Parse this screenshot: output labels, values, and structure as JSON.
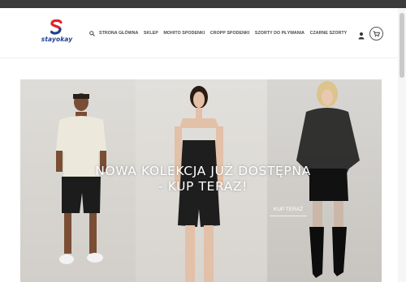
{
  "brand": {
    "name": "stayokay"
  },
  "nav": {
    "items": [
      "STRONA GŁÓWNA",
      "SKLEP",
      "MOHITO SPODENKI",
      "CROPP SPODENKI",
      "SZORTY DO PŁYWANIA",
      "CZARNE SZORTY"
    ]
  },
  "icons": {
    "search": "search-icon",
    "user": "user-icon",
    "cart": "cart-icon",
    "logo": "logo-mark"
  },
  "hero": {
    "title": "NOWA KOLEKCJA JUŻ DOSTĘPNA - KUP TERAZ!",
    "button": "KUP TERAZ"
  },
  "colors": {
    "topbar": "#3b3b3b",
    "brand_blue": "#1d3f8f",
    "brand_red": "#e2232a",
    "nav_text": "#4a4a4a"
  }
}
